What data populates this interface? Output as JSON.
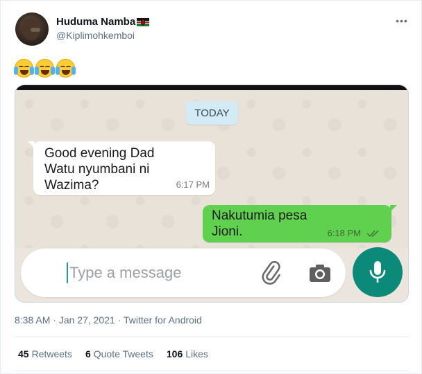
{
  "tweet": {
    "display_name": "Huduma Namba",
    "flag_icon": "kenya-flag-icon",
    "handle": "@Kiplimohkemboi",
    "emojis": [
      "face-with-tears-of-joy",
      "face-with-tears-of-joy",
      "face-with-tears-of-joy"
    ],
    "meta": {
      "time": "8:38 AM",
      "date": "Jan 27, 2021",
      "source": "Twitter for Android",
      "separator": "·"
    },
    "stats": {
      "retweets_count": "45",
      "retweets_label": "Retweets",
      "quote_count": "6",
      "quote_label": "Quote Tweets",
      "likes_count": "106",
      "likes_label": "Likes"
    }
  },
  "chat_screenshot": {
    "date_chip": "TODAY",
    "messages": [
      {
        "direction": "incoming",
        "lines": [
          "Good evening Dad",
          "Watu nyumbani ni",
          "Wazima?"
        ],
        "time": "6:17 PM"
      },
      {
        "direction": "outgoing",
        "lines": [
          "Nakutumia pesa",
          "Jioni."
        ],
        "time": "6:18 PM",
        "status": "read"
      }
    ],
    "input_placeholder": "Type a message",
    "colors": {
      "outgoing_bubble": "#60d14e",
      "mic_button": "#0b8a79",
      "wallpaper": "#e9e2d8",
      "date_chip": "#d4eaf4"
    }
  }
}
